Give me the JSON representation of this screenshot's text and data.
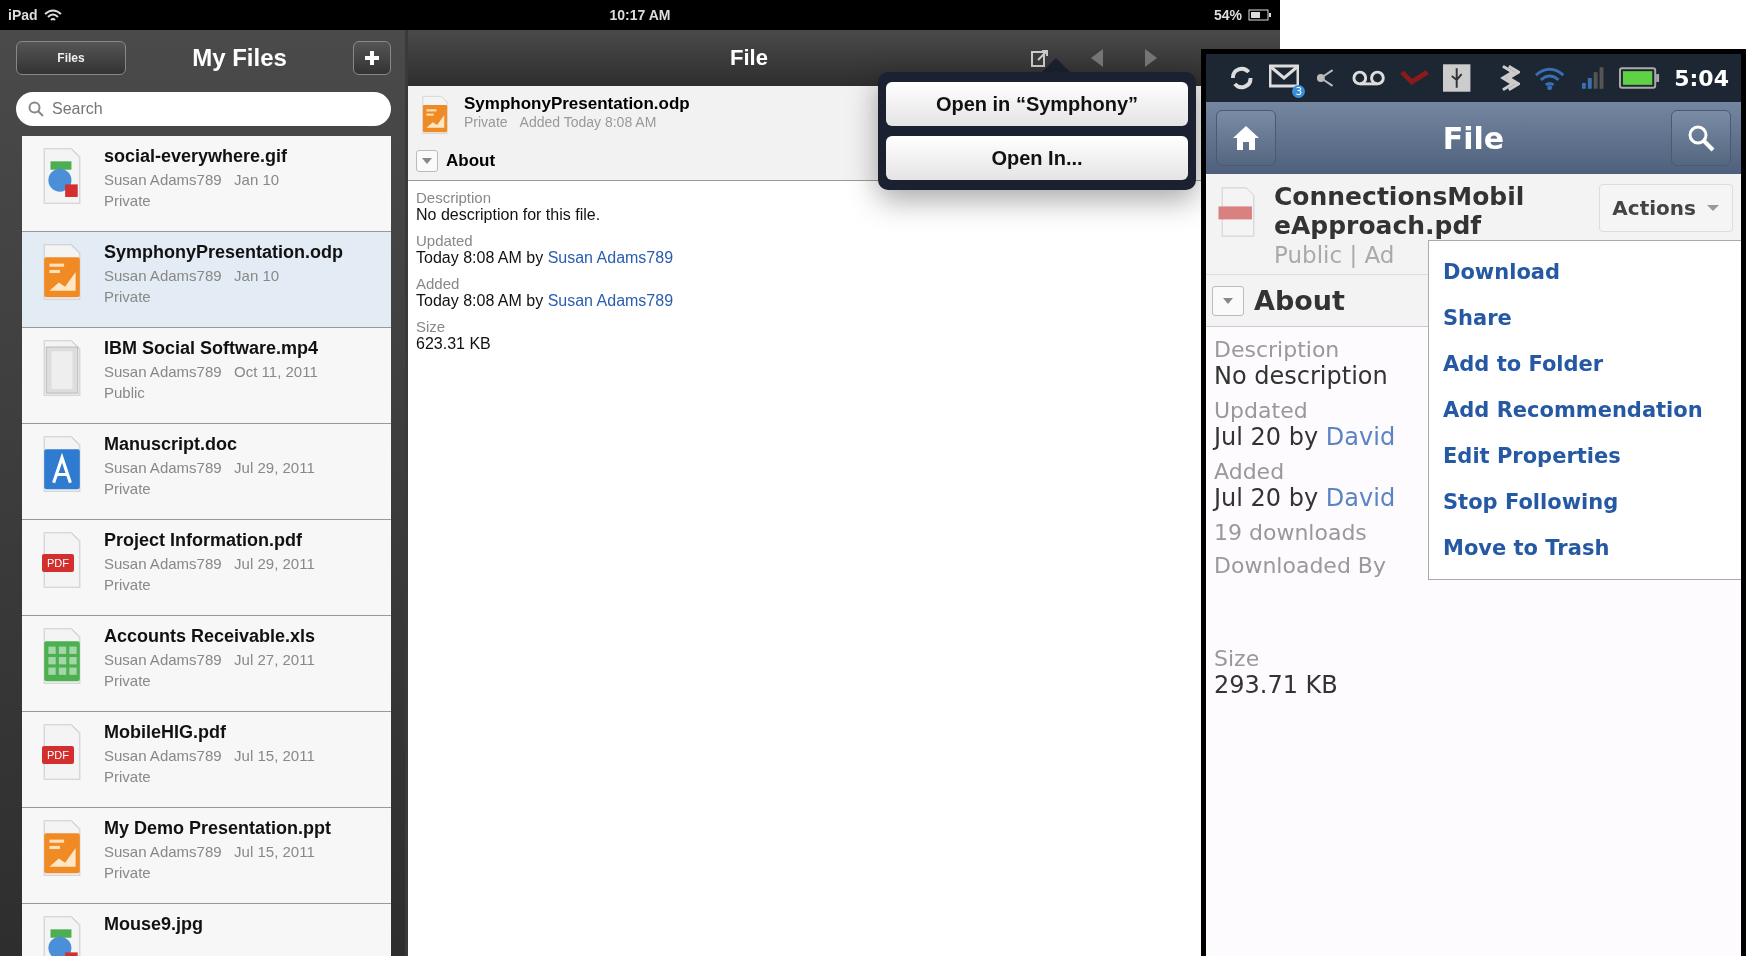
{
  "ipad": {
    "status_bar": {
      "device": "iPad",
      "time": "10:17 AM",
      "battery": "54%"
    },
    "sidebar": {
      "back_button": "Files",
      "title": "My Files",
      "search": {
        "placeholder": "Search"
      },
      "files": [
        {
          "name": "social-everywhere.gif",
          "author": "Susan Adams789",
          "date": "Jan 10",
          "visibility": "Private",
          "kind": "image",
          "selected": false
        },
        {
          "name": "SymphonyPresentation.odp",
          "author": "Susan Adams789",
          "date": "Jan 10",
          "visibility": "Private",
          "kind": "presentation",
          "selected": true
        },
        {
          "name": "IBM Social Software.mp4",
          "author": "Susan Adams789",
          "date": "Oct 11, 2011",
          "visibility": "Public",
          "kind": "video",
          "selected": false
        },
        {
          "name": "Manuscript.doc",
          "author": "Susan Adams789",
          "date": "Jul 29, 2011",
          "visibility": "Private",
          "kind": "document",
          "selected": false
        },
        {
          "name": "Project Information.pdf",
          "author": "Susan Adams789",
          "date": "Jul 29, 2011",
          "visibility": "Private",
          "kind": "pdf",
          "badge": "PDF",
          "selected": false
        },
        {
          "name": "Accounts Receivable.xls",
          "author": "Susan Adams789",
          "date": "Jul 27, 2011",
          "visibility": "Private",
          "kind": "spreadsheet",
          "selected": false
        },
        {
          "name": "MobileHIG.pdf",
          "author": "Susan Adams789",
          "date": "Jul 15, 2011",
          "visibility": "Private",
          "kind": "pdf",
          "badge": "PDF",
          "selected": false
        },
        {
          "name": "My Demo Presentation.ppt",
          "author": "Susan Adams789",
          "date": "Jul 15, 2011",
          "visibility": "Private",
          "kind": "presentation",
          "selected": false
        },
        {
          "name": "Mouse9.jpg",
          "kind": "image",
          "selected": false
        }
      ]
    },
    "detail": {
      "title": "File",
      "file": {
        "name": "SymphonyPresentation.odp",
        "visibility": "Private",
        "added": "Added Today 8:08 AM"
      },
      "section": {
        "title": "About",
        "expanded": true
      },
      "fields": [
        {
          "label": "Description",
          "value": "No description for this file."
        },
        {
          "label": "Updated",
          "value": "Today 8:08 AM by ",
          "link": "Susan Adams789"
        },
        {
          "label": "Added",
          "value": "Today 8:08 AM by ",
          "link": "Susan Adams789"
        },
        {
          "label": "Size",
          "value": "623.31 KB"
        }
      ],
      "popover": [
        "Open in “Symphony”",
        "Open In..."
      ]
    }
  },
  "android": {
    "status_bar": {
      "mail_badge": "3",
      "time": "5:04"
    },
    "header": {
      "title": "File"
    },
    "file": {
      "name": "ConnectionsMobileApproach.pdf",
      "meta": "Public | Ad",
      "actions_button": "Actions"
    },
    "actions_menu": [
      "Download",
      "Share",
      "Add to Folder",
      "Add Recommendation",
      "Edit Properties",
      "Stop Following",
      "Move to Trash"
    ],
    "section": {
      "title": "About",
      "expanded": true
    },
    "fields": [
      {
        "kind": "pair",
        "label": "Description",
        "value": "No description"
      },
      {
        "kind": "pair",
        "label": "Updated",
        "value": "Jul 20 by ",
        "link": "David"
      },
      {
        "kind": "pair",
        "label": "Added",
        "value": "Jul 20 by ",
        "link": "David"
      },
      {
        "kind": "note",
        "value": "19 downloads"
      },
      {
        "kind": "heading",
        "label": "Downloaded By"
      },
      {
        "kind": "pair",
        "label": "Size",
        "value": "293.71 KB"
      }
    ]
  }
}
